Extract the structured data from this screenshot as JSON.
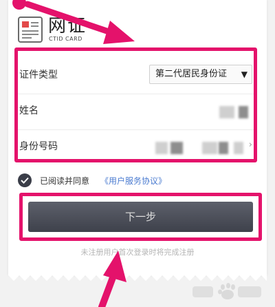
{
  "brand": {
    "name": "网证",
    "subtitle": "CTID CARD"
  },
  "form": {
    "id_type": {
      "label": "证件类型",
      "value": "第二代居民身份证",
      "arrow": "▼"
    },
    "name": {
      "label": "姓名"
    },
    "id_number": {
      "label": "身份号码",
      "chevron": "›"
    }
  },
  "agreement": {
    "text": "已阅读并同意",
    "link": "《用户服务协议》",
    "checked": true
  },
  "next_button": {
    "label": "下一步"
  },
  "note": "未注册用户首次登录时将完成注册",
  "colors": {
    "highlight": "#e4126b",
    "button": "#4a4d57",
    "link": "#4a7bd0"
  }
}
